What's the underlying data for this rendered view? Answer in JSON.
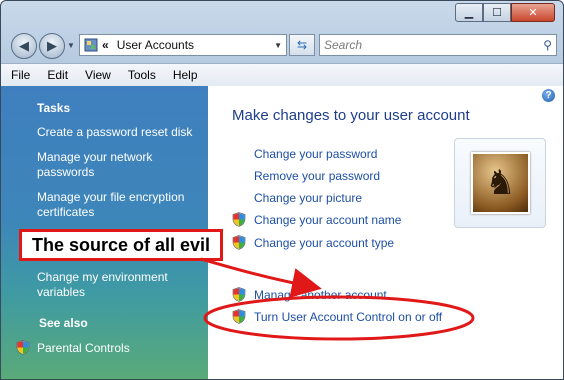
{
  "window": {
    "caption_buttons": [
      "minimize-icon",
      "maximize-icon",
      "close-icon"
    ]
  },
  "address": {
    "chevron": "«",
    "location": "User Accounts"
  },
  "search": {
    "placeholder": "Search"
  },
  "menu": [
    "File",
    "Edit",
    "View",
    "Tools",
    "Help"
  ],
  "left": {
    "tasks_heading": "Tasks",
    "tasks": [
      "Create a password reset disk",
      "Manage your network passwords",
      "Manage your file encryption certificates",
      "Change my environment variables"
    ],
    "see_also_heading": "See also",
    "see_also": [
      "Parental Controls"
    ]
  },
  "main": {
    "title": "Make changes to your user account",
    "actions": [
      {
        "label": "Change your password",
        "shield": false
      },
      {
        "label": "Remove your password",
        "shield": false
      },
      {
        "label": "Change your picture",
        "shield": false
      },
      {
        "label": "Change your account name",
        "shield": true
      },
      {
        "label": "Change your account type",
        "shield": true
      },
      {
        "label": "Manage another account",
        "shield": true
      },
      {
        "label": "Turn User Account Control on or off",
        "shield": true
      }
    ],
    "avatar_icon": "chess-pieces-icon"
  },
  "annotation": {
    "text": "The source of all evil",
    "color": "#e01818"
  }
}
